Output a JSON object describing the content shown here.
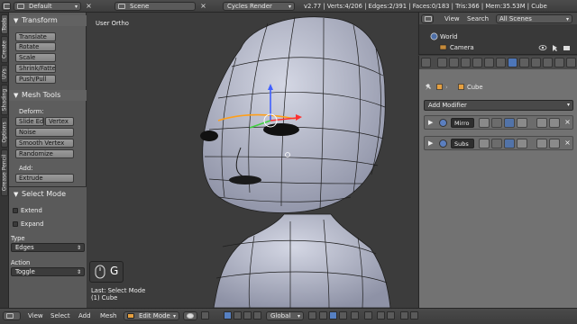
{
  "topbar": {
    "layout": "Default",
    "scene": "Scene",
    "engine": "Cycles Render",
    "stats": "v2.77 | Verts:4/206 | Edges:2/391 | Faces:0/183 | Tris:366 | Mem:35.53M | Cube"
  },
  "vtabs": [
    "Tools",
    "Create",
    "UVs",
    "Shading",
    "Options",
    "Grease Pencil"
  ],
  "toolshelf": {
    "transform": {
      "title": "Transform",
      "buttons": [
        "Translate",
        "Rotate",
        "Scale",
        "Shrink/Fatten",
        "Push/Pull"
      ]
    },
    "meshtools": {
      "title": "Mesh Tools",
      "deform_label": "Deform:",
      "deform_row": [
        "Slide Ed",
        "Vertex"
      ],
      "deform_buttons": [
        "Noise",
        "Smooth Vertex",
        "Randomize"
      ],
      "add_label": "Add:",
      "add_buttons": [
        "Extrude"
      ]
    },
    "selectmode": {
      "title": "Select Mode",
      "extend": "Extend",
      "expand": "Expand",
      "type_label": "Type",
      "type_value": "Edges",
      "action_label": "Action",
      "action_value": "Toggle"
    }
  },
  "viewport": {
    "title": "User Ortho",
    "key": "G",
    "last_op": "Last: Select Mode",
    "object_label": "(1) Cube"
  },
  "bottombar": {
    "menus": [
      "View",
      "Select",
      "Add",
      "Mesh"
    ],
    "mode": "Edit Mode",
    "orientation": "Global"
  },
  "outliner": {
    "menus": [
      "View",
      "Search"
    ],
    "scenes": "All Scenes",
    "items": [
      "World",
      "Camera"
    ]
  },
  "properties": {
    "object_name": "Cube",
    "add_modifier": "Add Modifier",
    "modifiers": [
      "Mirro",
      "Subs"
    ]
  },
  "colors": {
    "accent": "#5680c2",
    "mesh": "#b3b8cc",
    "wire": "#1e1e1e"
  }
}
